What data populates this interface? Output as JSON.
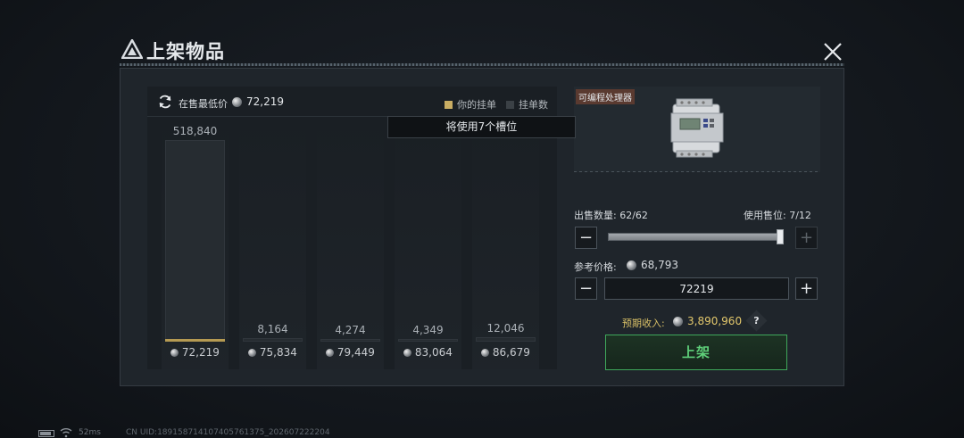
{
  "window": {
    "title": "上架物品",
    "close_icon": "close-icon"
  },
  "chart_header": {
    "lowest_label": "在售最低价",
    "lowest_value": "72,219",
    "legend_yours": "你的挂单",
    "legend_count": "挂单数",
    "legend_colors": {
      "yours": "#c9ad63",
      "count": "#3b4146"
    }
  },
  "tooltip": "将使用7个槽位",
  "chart_data": {
    "type": "bar",
    "categories": [
      "72,219",
      "75,834",
      "79,449",
      "83,064",
      "86,679"
    ],
    "values": [
      518840,
      8164,
      4274,
      4349,
      12046
    ],
    "value_labels": [
      "518,840",
      "8,164",
      "4,274",
      "4,349",
      "12,046"
    ],
    "your_listing_category": "72,219"
  },
  "item": {
    "name": "可编程处理器",
    "image_icon": "programmable-processor-icon"
  },
  "sale": {
    "qty_label": "出售数量: 62/62",
    "slots_label": "使用售位: 7/12",
    "slider_fraction": 1.0,
    "ref_label": "参考价格:",
    "ref_value": "68,793",
    "price_value": "72219",
    "income_label": "预期收入:",
    "income_value": "3,890,960",
    "help_glyph": "?",
    "list_button": "上架",
    "minus_glyph": "−",
    "plus_glyph": "+"
  },
  "status": {
    "ping": "52ms",
    "uid": "CN UID:1891587141074057613​75_202607222204"
  }
}
